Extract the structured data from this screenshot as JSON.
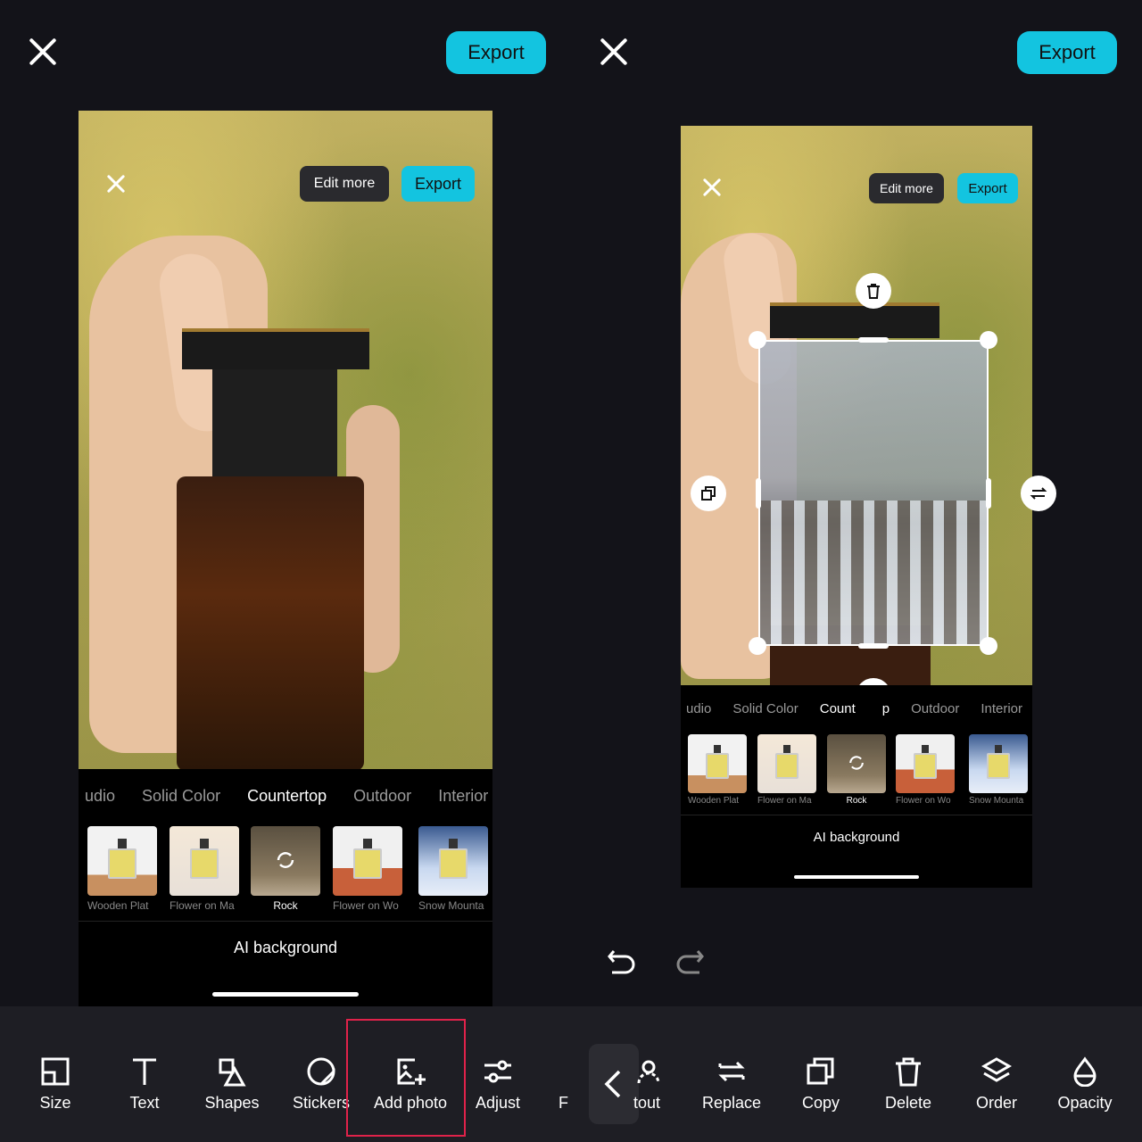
{
  "left": {
    "export_label": "Export",
    "edit_more": "Edit more",
    "mini_export": "Export",
    "categories": [
      "udio",
      "Solid Color",
      "Countertop",
      "Outdoor",
      "Interior"
    ],
    "active_category": "Countertop",
    "thumbnails": [
      "Wooden Plat",
      "Flower on Ma",
      "Rock",
      "Flower on Wo",
      "Snow Mounta"
    ],
    "ai_background": "AI background",
    "tools": [
      "Size",
      "Text",
      "Shapes",
      "Stickers",
      "Add photo",
      "Adjust",
      "F"
    ]
  },
  "right": {
    "export_label": "Export",
    "edit_more": "Edit more",
    "mini_export": "Export",
    "categories": [
      "udio",
      "Solid Color",
      "Count",
      "p",
      "Outdoor",
      "Interior"
    ],
    "thumbnails": [
      "Wooden Plat",
      "Flower on Ma",
      "Rock",
      "Flower on Wo",
      "Snow Mounta"
    ],
    "ai_background": "AI background",
    "tools": [
      "tout",
      "Replace",
      "Copy",
      "Delete",
      "Order",
      "Opacity"
    ]
  },
  "colors": {
    "accent": "#13c4e0",
    "highlight": "#e0224a"
  }
}
